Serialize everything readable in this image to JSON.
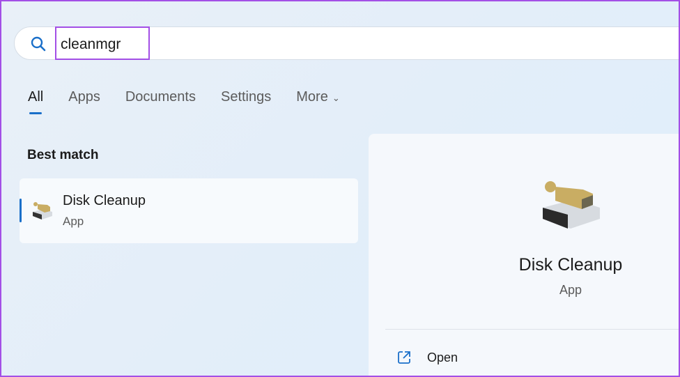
{
  "search": {
    "query": "cleanmgr"
  },
  "tabs": [
    {
      "label": "All"
    },
    {
      "label": "Apps"
    },
    {
      "label": "Documents"
    },
    {
      "label": "Settings"
    },
    {
      "label": "More"
    }
  ],
  "best_match": {
    "title": "Best match",
    "name": "Disk Cleanup",
    "type": "App"
  },
  "detail": {
    "name": "Disk Cleanup",
    "type": "App",
    "actions": [
      {
        "label": "Open"
      }
    ]
  },
  "colors": {
    "accent": "#1a6fc9",
    "highlight": "#a34fe6"
  }
}
